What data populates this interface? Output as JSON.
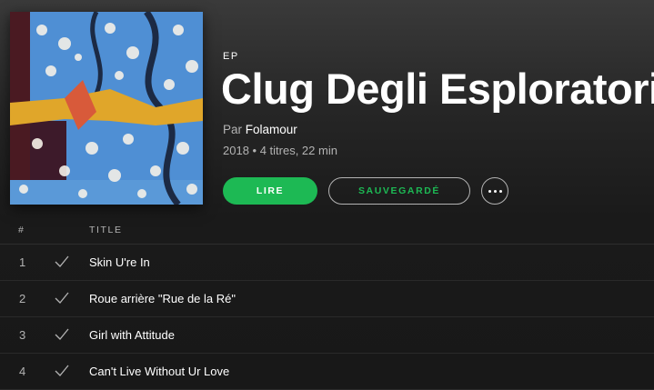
{
  "album": {
    "type_label": "EP",
    "title": "Clug Degli Esploratori",
    "by_prefix": "Par",
    "artist": "Folamour",
    "meta": "2018 • 4 titres, 22 min"
  },
  "actions": {
    "play_label": "LIRE",
    "save_label": "SAUVEGARDÉ",
    "more_icon": "more-horizontal-icon"
  },
  "tracklist": {
    "header": {
      "number": "#",
      "title": "TITLE"
    },
    "tracks": [
      {
        "number": "1",
        "title": "Skin U're In",
        "saved": true
      },
      {
        "number": "2",
        "title": "Roue arrière \"Rue de la Ré\"",
        "saved": true
      },
      {
        "number": "3",
        "title": "Girl with Attitude",
        "saved": true
      },
      {
        "number": "4",
        "title": "Can't Live Without Ur Love",
        "saved": true
      }
    ]
  },
  "colors": {
    "accent": "#1db954",
    "background": "#181818",
    "muted_text": "#b3b3b3"
  }
}
